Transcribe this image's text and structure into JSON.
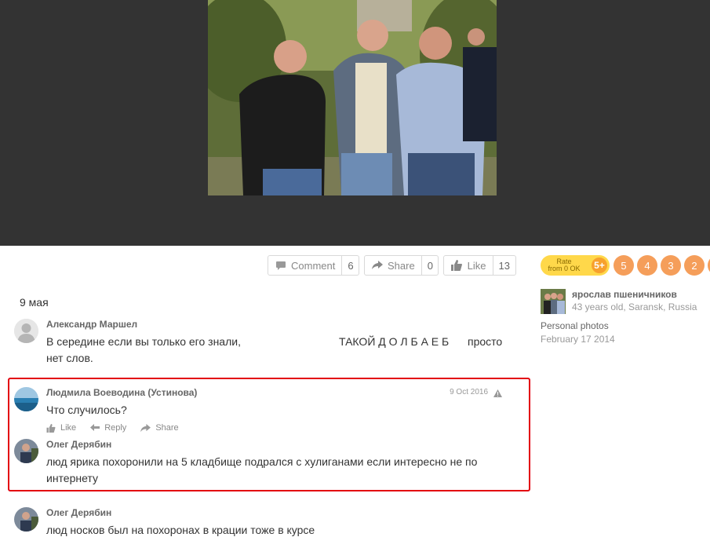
{
  "toolbar": {
    "comment_label": "Comment",
    "comment_count": "6",
    "share_label": "Share",
    "share_count": "0",
    "like_label": "Like",
    "like_count": "13"
  },
  "rating": {
    "title_line1": "Rate",
    "title_line2": "from 0 OK",
    "top_value": "5+",
    "values": [
      "5",
      "4",
      "3",
      "2"
    ]
  },
  "owner": {
    "name": "ярослав пшеничников",
    "info": "43 years old, Saransk, Russia",
    "album": "Personal photos",
    "date": "February 17 2014"
  },
  "caption": "9 мая",
  "comments": [
    {
      "author": "Александр Маршел",
      "line1_a": "В середине если вы только его знали,",
      "line1_b": "ТАКОЙ  Д О Л  Б А Е Б",
      "line1_c": "просто",
      "line2": "нет слов."
    },
    {
      "author": "Людмила Воеводина (Устинова)",
      "time": "9 Oct 2016",
      "text": "Что случилось?",
      "actions": {
        "like": "Like",
        "reply": "Reply",
        "share": "Share"
      }
    },
    {
      "author": "Олег Дерябин",
      "line1": "люд ярика похоронили на 5 кладбище подрался с хулиганами если интересно не по",
      "line2": "интернету"
    },
    {
      "author": "Олег Дерябин",
      "text": "люд носков был на похоронах в крации тоже в курсе"
    }
  ],
  "colors": {
    "viewer_bg": "#333333",
    "highlight": "#e3000f",
    "rate_yellow": "#ffd84a",
    "rate_orange": "#f59e5a"
  }
}
